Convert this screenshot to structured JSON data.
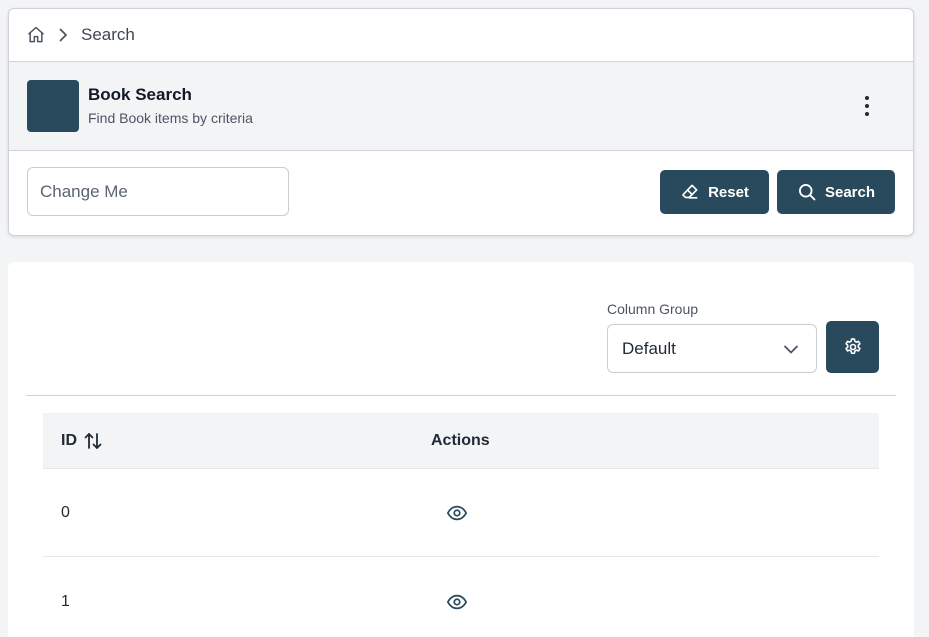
{
  "breadcrumb": {
    "home_icon": "home-icon",
    "separator_icon": "chevron-right-icon",
    "current": "Search"
  },
  "header": {
    "title": "Book Search",
    "subtitle": "Find Book items by criteria",
    "menu_icon": "more-vertical-icon"
  },
  "search": {
    "placeholder": "Change Me",
    "value": "",
    "reset_label": "Reset",
    "reset_icon": "eraser-icon",
    "search_label": "Search",
    "search_icon": "search-icon"
  },
  "table_controls": {
    "column_group_label": "Column Group",
    "column_group_selected": "Default",
    "settings_icon": "gear-icon"
  },
  "table": {
    "columns": [
      {
        "label": "ID",
        "sortable": true,
        "sort_icon": "sort-arrows-icon"
      },
      {
        "label": "Actions"
      }
    ],
    "rows": [
      {
        "id": "0",
        "action_icon": "eye-icon"
      },
      {
        "id": "1",
        "action_icon": "eye-icon"
      }
    ]
  },
  "colors": {
    "primary": "#294a5c",
    "background": "#f3f4f6",
    "border": "#cfd3d8"
  }
}
